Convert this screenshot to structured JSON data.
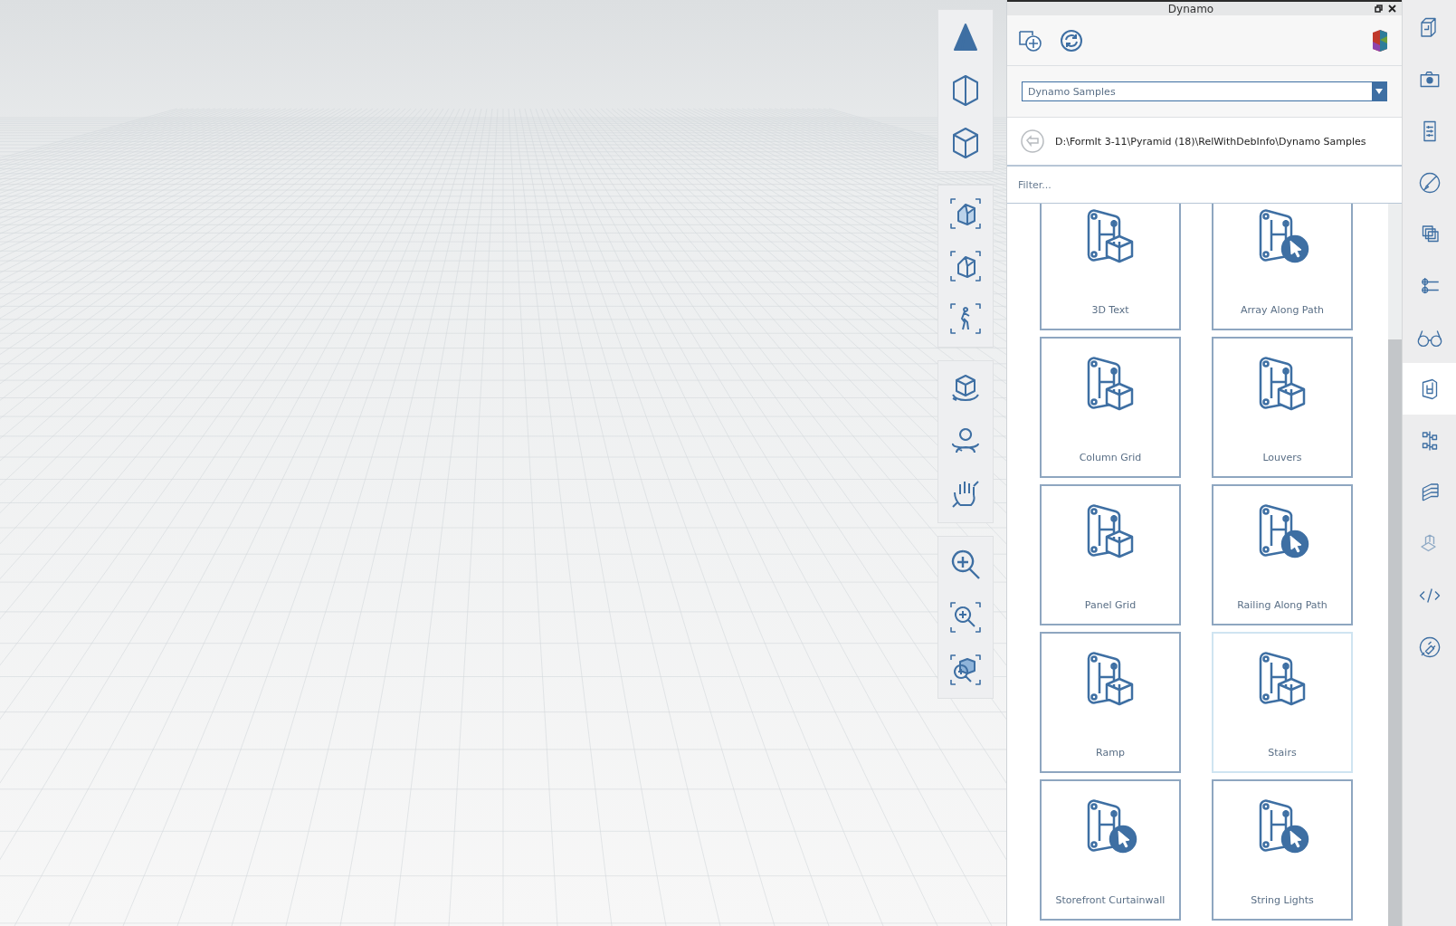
{
  "panel": {
    "title": "Dynamo",
    "dropdown": {
      "value": "Dynamo Samples"
    },
    "path": "D:\\FormIt 3-11\\Pyramid (18)\\RelWithDebInfo\\Dynamo Samples",
    "filter": {
      "placeholder": "Filter..."
    },
    "samples": [
      {
        "label": "3D Text",
        "kind": "cube",
        "selected": false
      },
      {
        "label": "Array Along Path",
        "kind": "cursor",
        "selected": false
      },
      {
        "label": "Column Grid",
        "kind": "cube",
        "selected": false
      },
      {
        "label": "Louvers",
        "kind": "cube",
        "selected": false
      },
      {
        "label": "Panel Grid",
        "kind": "cube",
        "selected": false
      },
      {
        "label": "Railing Along Path",
        "kind": "cursor",
        "selected": false
      },
      {
        "label": "Ramp",
        "kind": "cube",
        "selected": false
      },
      {
        "label": "Stairs",
        "kind": "cube",
        "selected": true
      },
      {
        "label": "Storefront Curtainwall",
        "kind": "cursor",
        "selected": false
      },
      {
        "label": "String Lights",
        "kind": "cursor",
        "selected": false
      }
    ]
  },
  "side_bar": {
    "items": [
      {
        "selected": false
      },
      {
        "selected": false
      },
      {
        "selected": false
      },
      {
        "selected": false
      },
      {
        "selected": false
      },
      {
        "selected": false
      },
      {
        "selected": false
      },
      {
        "selected": true
      },
      {
        "selected": false
      },
      {
        "selected": false
      },
      {
        "selected": false
      },
      {
        "selected": false
      },
      {
        "selected": false
      }
    ]
  }
}
